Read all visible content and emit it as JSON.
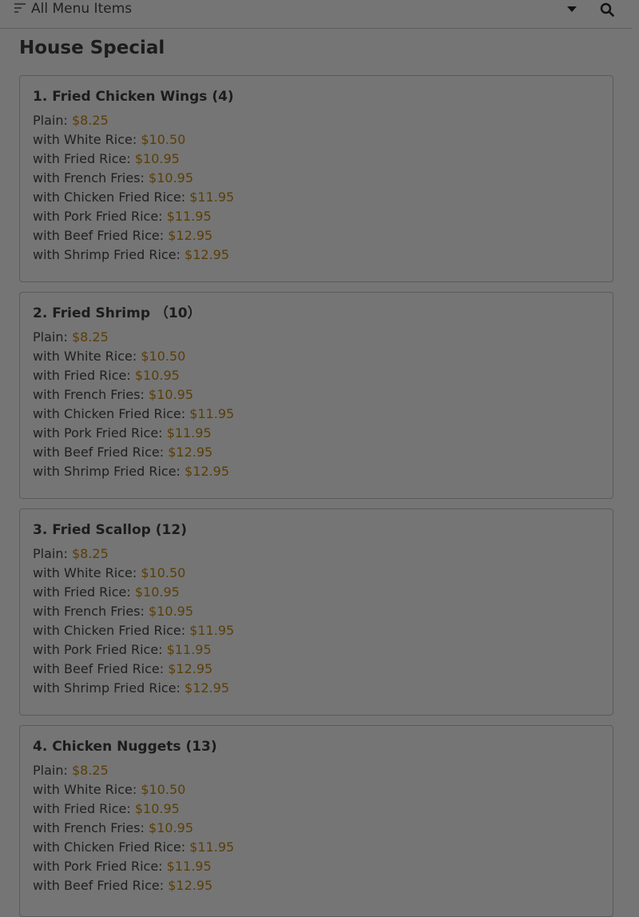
{
  "header": {
    "title": "All Menu Items"
  },
  "section": {
    "title": "House Special"
  },
  "items": [
    {
      "name": "1. Fried Chicken Wings (4)",
      "prices": [
        {
          "label": "Plain:",
          "price": "$8.25"
        },
        {
          "label": "with White Rice:",
          "price": "$10.50"
        },
        {
          "label": "with Fried Rice:",
          "price": "$10.95"
        },
        {
          "label": "with French Fries:",
          "price": "$10.95"
        },
        {
          "label": "with Chicken Fried Rice:",
          "price": "$11.95"
        },
        {
          "label": "with Pork Fried Rice:",
          "price": "$11.95"
        },
        {
          "label": "with Beef Fried Rice:",
          "price": "$12.95"
        },
        {
          "label": "with Shrimp Fried Rice:",
          "price": "$12.95"
        }
      ]
    },
    {
      "name": "2. Fried Shrimp （10）",
      "prices": [
        {
          "label": "Plain:",
          "price": "$8.25"
        },
        {
          "label": "with White Rice:",
          "price": "$10.50"
        },
        {
          "label": "with Fried Rice:",
          "price": "$10.95"
        },
        {
          "label": "with French Fries:",
          "price": "$10.95"
        },
        {
          "label": "with Chicken Fried Rice:",
          "price": "$11.95"
        },
        {
          "label": "with Pork Fried Rice:",
          "price": "$11.95"
        },
        {
          "label": "with Beef Fried Rice:",
          "price": "$12.95"
        },
        {
          "label": "with Shrimp Fried Rice:",
          "price": "$12.95"
        }
      ]
    },
    {
      "name": "3. Fried Scallop (12)",
      "prices": [
        {
          "label": "Plain:",
          "price": "$8.25"
        },
        {
          "label": "with White Rice:",
          "price": "$10.50"
        },
        {
          "label": "with Fried Rice:",
          "price": "$10.95"
        },
        {
          "label": "with French Fries:",
          "price": "$10.95"
        },
        {
          "label": "with Chicken Fried Rice:",
          "price": "$11.95"
        },
        {
          "label": "with Pork Fried Rice:",
          "price": "$11.95"
        },
        {
          "label": "with Beef Fried Rice:",
          "price": "$12.95"
        },
        {
          "label": "with Shrimp Fried Rice:",
          "price": "$12.95"
        }
      ]
    },
    {
      "name": "4. Chicken Nuggets (13)",
      "prices": [
        {
          "label": "Plain:",
          "price": "$8.25"
        },
        {
          "label": "with White Rice:",
          "price": "$10.50"
        },
        {
          "label": "with Fried Rice:",
          "price": "$10.95"
        },
        {
          "label": "with French Fries:",
          "price": "$10.95"
        },
        {
          "label": "with Chicken Fried Rice:",
          "price": "$11.95"
        },
        {
          "label": "with Pork Fried Rice:",
          "price": "$11.95"
        },
        {
          "label": "with Beef Fried Rice:",
          "price": "$12.95"
        }
      ]
    }
  ],
  "icons": {
    "filter": "filter-icon",
    "dropdown": "caret-down-icon",
    "search": "search-icon"
  },
  "colors": {
    "overlay_background": "#757575",
    "price_text": "#5a3e05"
  }
}
